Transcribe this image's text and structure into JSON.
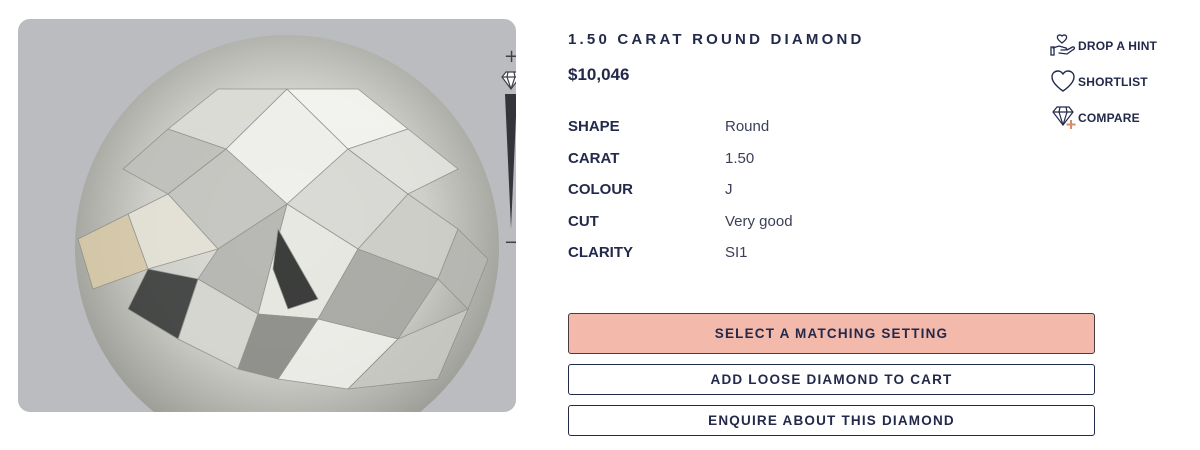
{
  "product": {
    "title": "1.50 CARAT ROUND DIAMOND",
    "price": "$10,046"
  },
  "specs": [
    {
      "label": "SHAPE",
      "value": "Round"
    },
    {
      "label": "CARAT",
      "value": "1.50"
    },
    {
      "label": "COLOUR",
      "value": "J"
    },
    {
      "label": "CUT",
      "value": "Very good"
    },
    {
      "label": "CLARITY",
      "value": "SI1"
    }
  ],
  "side_actions": {
    "hint": {
      "label": "DROP A HINT",
      "icon": "hand-heart-icon"
    },
    "shortlist": {
      "label": "SHORTLIST",
      "icon": "heart-icon"
    },
    "compare": {
      "label": "COMPARE",
      "icon": "diamond-plus-icon"
    }
  },
  "viewer": {
    "zoom_in": "+",
    "zoom_out": "−"
  },
  "buttons": {
    "select_setting": "SELECT A MATCHING SETTING",
    "add_to_cart": "ADD LOOSE DIAMOND TO CART",
    "enquire": "ENQUIRE ABOUT THIS DIAMOND"
  },
  "colors": {
    "primary_button": "#f3b9ab",
    "text": "#23294a",
    "viewer_bg": "#babcbf"
  }
}
